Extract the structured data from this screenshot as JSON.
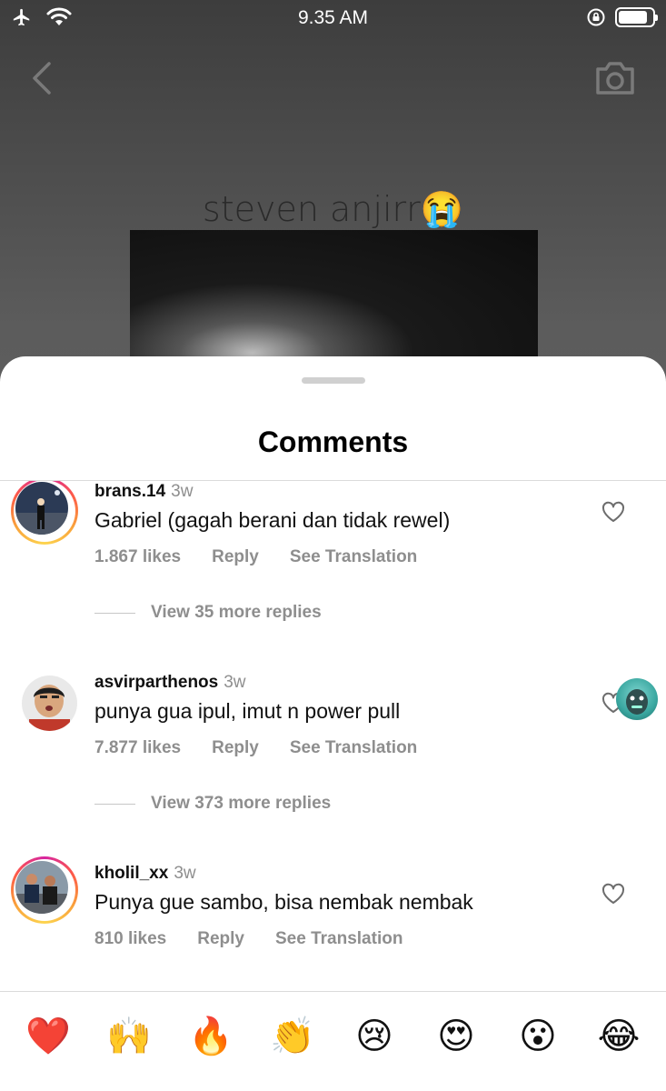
{
  "status_bar": {
    "time": "9.35 AM"
  },
  "story": {
    "caption": "steven anjirr",
    "caption_emoji": "😭"
  },
  "sheet": {
    "title": "Comments"
  },
  "comments": [
    {
      "username": "brans.14",
      "time": "3w",
      "text": "Gabriel (gagah berani dan tidak rewel)",
      "likes": "1.867 likes",
      "reply_label": "Reply",
      "translate_label": "See Translation",
      "view_replies": "View 35 more replies",
      "has_story_ring": true
    },
    {
      "username": "asvirparthenos",
      "time": "3w",
      "text": "punya gua ipul, imut n power pull",
      "likes": "7.877 likes",
      "reply_label": "Reply",
      "translate_label": "See Translation",
      "view_replies": "View 373 more replies",
      "has_story_ring": false
    },
    {
      "username": "kholil_xx",
      "time": "3w",
      "text": "Punya gue sambo, bisa nembak nembak",
      "likes": "810 likes",
      "reply_label": "Reply",
      "translate_label": "See Translation",
      "has_story_ring": true
    }
  ],
  "emoji_bar": [
    "❤️",
    "🙌",
    "🔥",
    "👏",
    "😢",
    "😍",
    "😮",
    "😂"
  ],
  "icons": {
    "status_left": [
      "airplane-icon",
      "wifi-icon"
    ],
    "status_right": [
      "orientation-lock-icon",
      "battery-icon"
    ],
    "back": "chevron-left-icon",
    "camera": "camera-icon",
    "like": "heart-outline-icon"
  },
  "colors": {
    "sheet_bg": "#ffffff",
    "meta_gray": "#8e8e8e",
    "divider": "#dbdbdb",
    "ring_start": "#d6249f",
    "ring_end": "#fdd54f"
  },
  "battery_level": 0.85
}
